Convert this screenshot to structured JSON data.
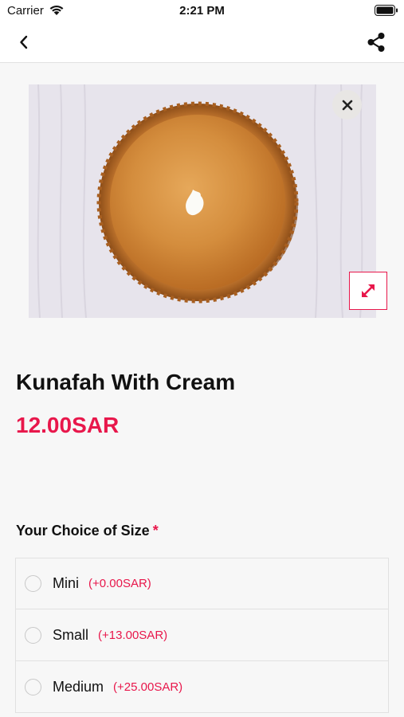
{
  "status_bar": {
    "carrier": "Carrier",
    "time": "2:21 PM",
    "wifi_icon": "wifi-icon",
    "battery_icon": "battery-icon"
  },
  "nav": {
    "back_icon": "chevron-left-icon",
    "share_icon": "share-icon"
  },
  "image": {
    "close_icon": "close-icon",
    "expand_icon": "expand-arrows-icon"
  },
  "product": {
    "title": "Kunafah With Cream",
    "price": "12.00SAR"
  },
  "size_section": {
    "heading": "Your Choice of Size",
    "required_marker": "*",
    "options": [
      {
        "name": "Mini",
        "price": "(+0.00SAR)"
      },
      {
        "name": "Small",
        "price": "(+13.00SAR)"
      },
      {
        "name": "Medium",
        "price": "(+25.00SAR)"
      }
    ]
  },
  "colors": {
    "accent": "#e8174b",
    "background": "#f7f7f7"
  }
}
